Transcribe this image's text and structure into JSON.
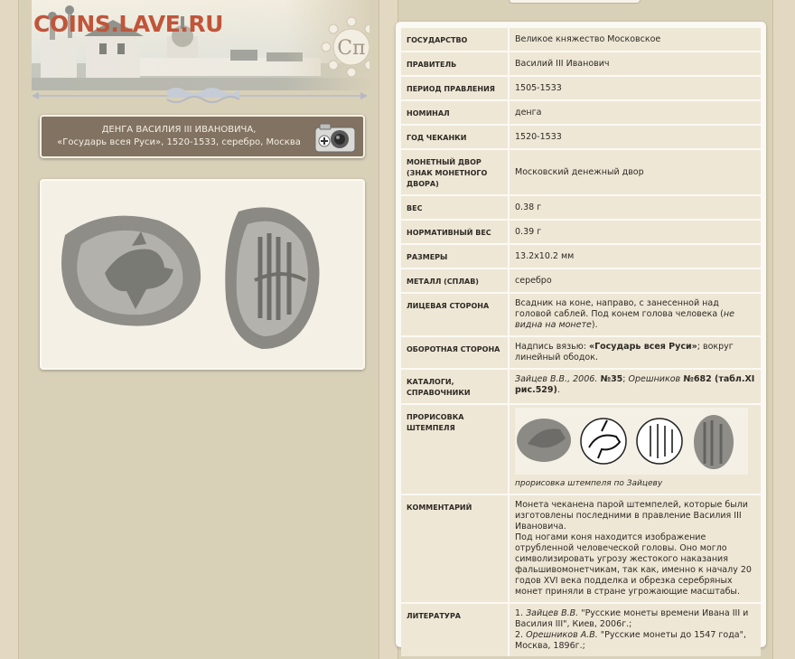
{
  "site": {
    "brand": "COINS.LAVE.RU",
    "emblem_letters": "Сп"
  },
  "coin": {
    "title_line1": "ДЕНГА ВАСИЛИЯ III ИВАНОВИЧА,",
    "title_line2": "«Государь всея Руси», 1520-1533, серебро, Москва"
  },
  "info": {
    "state_label": "ГОСУДАРСТВО",
    "state": "Великое княжество Московское",
    "ruler_label": "ПРАВИТЕЛЬ",
    "ruler": "Василий III Иванович",
    "reign_label": "ПЕРИОД ПРАВЛЕНИЯ",
    "reign": "1505-1533",
    "denomination_label": "НОМИНАЛ",
    "denomination": "денга",
    "minted_label": "ГОД ЧЕКАНКИ",
    "minted": "1520-1533",
    "mint_label": "МОНЕТНЫЙ ДВОР (ЗНАК МОНЕТНОГО ДВОРА)",
    "mint": "Московский денежный двор",
    "weight_label": "ВЕС",
    "weight": "0.38 г",
    "norm_weight_label": "НОРМАТИВНЫЙ ВЕС",
    "norm_weight": "0.39 г",
    "size_label": "РАЗМЕРЫ",
    "size": "13.2x10.2 мм",
    "metal_label": "МЕТАЛЛ (СПЛАВ)",
    "metal": "серебро",
    "obverse_label": "ЛИЦЕВАЯ СТОРОНА",
    "obverse_a": "Всадник на коне, направо, с занесенной над головой саблей. Под конем голова человека (",
    "obverse_b": "не видна на монете",
    "obverse_c": ").",
    "reverse_label": "ОБОРОТНАЯ СТОРОНА",
    "reverse_a": "Надпись вязью: ",
    "reverse_b": "«Государь всея Руси»",
    "reverse_c": "; вокруг линейный ободок.",
    "catalogs_label": "КАТАЛОГИ, СПРАВОЧНИКИ",
    "cat_a": "Зайцев В.В., 2006.",
    "cat_b": " №35",
    "cat_c": "; ",
    "cat_d": "Орешников",
    "cat_e": " №682 (табл.XI рис.529)",
    "cat_f": ".",
    "drawing_label": "ПРОРИСОВКА ШТЕМПЕЛЯ",
    "drawing_caption": "прорисовка штемпеля по Зайцеву",
    "comment_label": "КОММЕНТАРИЙ",
    "comment_1": "Монета чеканена парой штемпелей, которые были изготовлены последними в правление Василия III Ивановича.",
    "comment_2": "Под ногами коня находится изображение отрубленной человеческой головы. Оно могло символизировать угрозу жестокого наказания фальшивомонетчикам, так как, именно к началу 20 годов XVI века подделка и обрезка серебряных монет приняли в стране угрожающие масштабы.",
    "literature_label": "ЛИТЕРАТУРА",
    "lit1_num": "1. ",
    "lit1_author": "Зайцев В.В.",
    "lit1_title": " \"Русские монеты времени Ивана III и Василия III\", Киев, 2006г.;",
    "lit2_num": "2. ",
    "lit2_author": "Орешников А.В.",
    "lit2_title": " \"Русские монеты до 1547 года\", Москва, 1896г.;"
  }
}
